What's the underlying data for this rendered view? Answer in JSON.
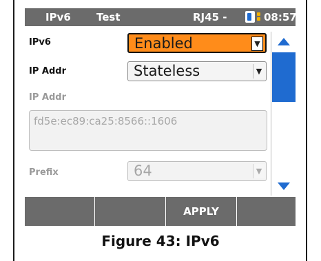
{
  "statusbar": {
    "title": "IPv6",
    "mode": "Test",
    "port": "RJ45 -",
    "battery_icon": "battery-icon",
    "signal_icon": "signal-icon",
    "time": "08:57"
  },
  "form": {
    "ipv6": {
      "label": "IPv6",
      "value": "Enabled"
    },
    "ip_addr_mode": {
      "label": "IP Addr",
      "value": "Stateless"
    },
    "ip_addr": {
      "label": "IP Addr",
      "value": "fd5e:ec89:ca25:8566::1606"
    },
    "prefix": {
      "label": "Prefix",
      "value": "64"
    }
  },
  "scrollbar": {
    "up_icon": "arrow-up-icon",
    "down_icon": "arrow-down-icon"
  },
  "softkeys": [
    "",
    "",
    "APPLY",
    ""
  ],
  "caption": "Figure 43: IPv6",
  "colors": {
    "accent": "#1f6bd0",
    "selected_field": "#ff8c1a",
    "bar": "#6b6b6b"
  }
}
